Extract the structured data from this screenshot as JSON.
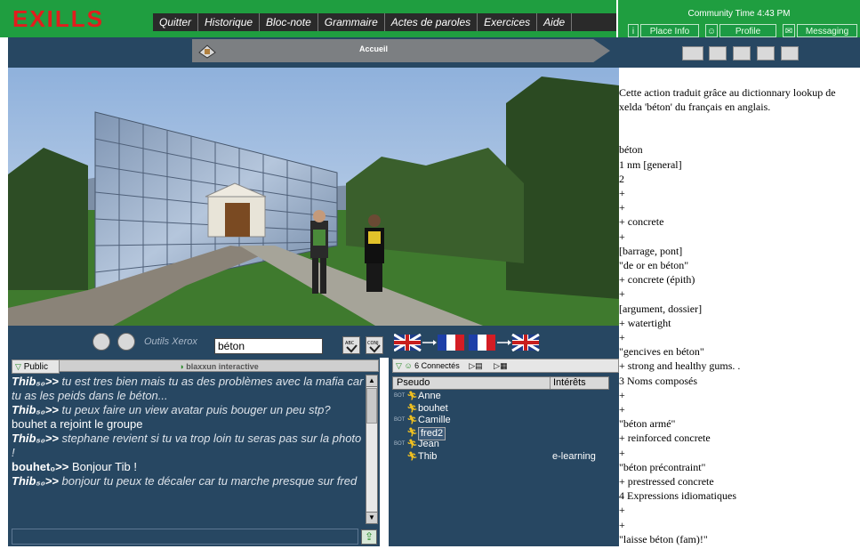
{
  "app": {
    "logo": "EXILLS"
  },
  "menu": [
    "Quitter",
    "Historique",
    "Bloc-note",
    "Grammaire",
    "Actes de paroles",
    "Exercices",
    "Aide"
  ],
  "community": {
    "time": "Community Time 4:43 PM",
    "buttons": [
      "Place Info",
      "Profile",
      "Messaging"
    ]
  },
  "nav": {
    "location": "Accueil"
  },
  "tools": {
    "label": "Outils Xerox",
    "word": "béton"
  },
  "chat": {
    "tab": "Public",
    "banner": "blaxxun interactive",
    "messages": [
      {
        "nick": "Thib₅₀>>",
        "text": "tu est tres bien mais tu as des problèmes avec la mafia car tu as les peids dans le béton..."
      },
      {
        "nick": "Thib₅₀>>",
        "text": "tu peux faire un view avatar puis bouger un peu stp?"
      },
      {
        "system": "bouhet a rejoint le groupe"
      },
      {
        "nick": "Thib₅₀>>",
        "text": "stephane revient si tu va trop loin tu seras pas sur la photo !"
      },
      {
        "nick": "bouhet₀>>",
        "text": "Bonjour Tib !",
        "plain": true
      },
      {
        "nick": "Thib₅₀>>",
        "text": "bonjour tu peux te décaler car tu marche presque sur fred"
      }
    ]
  },
  "users": {
    "connected_label": "6 Connectés",
    "columns": [
      "Pseudo",
      "Intérêts"
    ],
    "rows": [
      {
        "tag": "BOT",
        "name": "Anne",
        "interest": ""
      },
      {
        "tag": "",
        "name": "bouhet",
        "interest": ""
      },
      {
        "tag": "BOT",
        "name": "Camille",
        "interest": ""
      },
      {
        "tag": "",
        "name": "fred2",
        "interest": "",
        "selected": true
      },
      {
        "tag": "BOT",
        "name": "Jean",
        "interest": ""
      },
      {
        "tag": "",
        "name": "Thib",
        "interest": "e-learning"
      }
    ]
  },
  "dictionary": {
    "intro": "Cette action traduit grâce au dictionnary lookup de xelda 'béton' du français en anglais.",
    "lines": [
      "béton",
      "1 nm [general]",
      "2",
      "+",
      "+",
      "+ concrete",
      "+",
      "[barrage, pont]",
      "\"de or en béton\"",
      "+ concrete (épith)",
      "+",
      "[argument, dossier]",
      "+ watertight",
      "+",
      "\"gencives en béton\"",
      "+ strong and healthy gums. .",
      "3 Noms composés",
      "+",
      "+",
      "\"béton armé\"",
      "+ reinforced concrete",
      "+",
      "\"béton précontraint\"",
      "+ prestressed concrete",
      "4 Expressions idiomatiques",
      "+",
      "+",
      "\"laisse béton (fam)!\""
    ]
  },
  "colors": {
    "green": "#1f9e40",
    "navy": "#274762",
    "logo": "#e21d1d"
  },
  "icons": [
    "house-icon",
    "view-icons",
    "abc-check-icon",
    "conj-check-icon",
    "en-fr-flag-icon",
    "fr-en-flag-icon",
    "send-icon"
  ]
}
